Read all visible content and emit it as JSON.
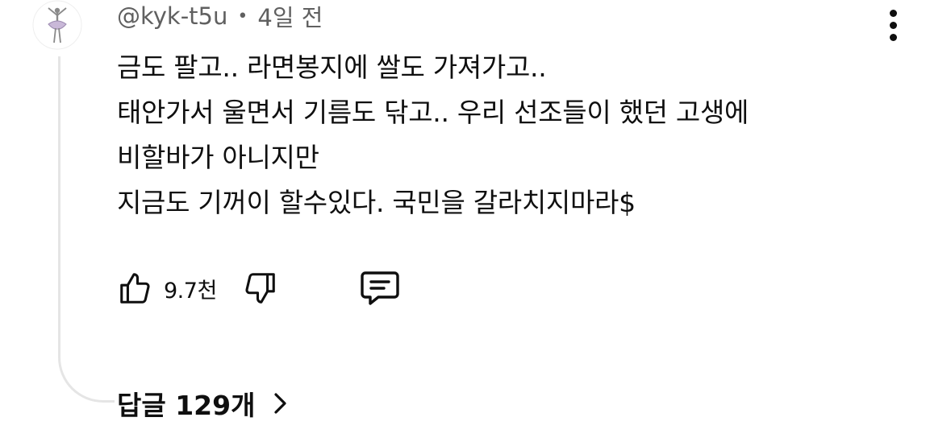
{
  "comment": {
    "author": "@kyk-t5u",
    "separator": "•",
    "time": "4일 전",
    "lines": [
      "금도 팔고.. 라면봉지에 쌀도 가져가고..",
      "태안가서 울면서 기름도 닦고.. 우리 선조들이 했던 고생에",
      "비할바가 아니지만",
      "지금도 기꺼이 할수있다. 국민을 갈라치지마라$"
    ],
    "like_count": "9.7천",
    "replies_label": "답글 129개"
  },
  "icons": {
    "more": "more-vertical-icon",
    "like": "thumbs-up-icon",
    "dislike": "thumbs-down-icon",
    "reply": "comment-icon",
    "chevron": "chevron-right-icon"
  },
  "colors": {
    "text": "#0f0f0f",
    "meta_text": "#606060",
    "thread_line": "#e5e5e5"
  }
}
